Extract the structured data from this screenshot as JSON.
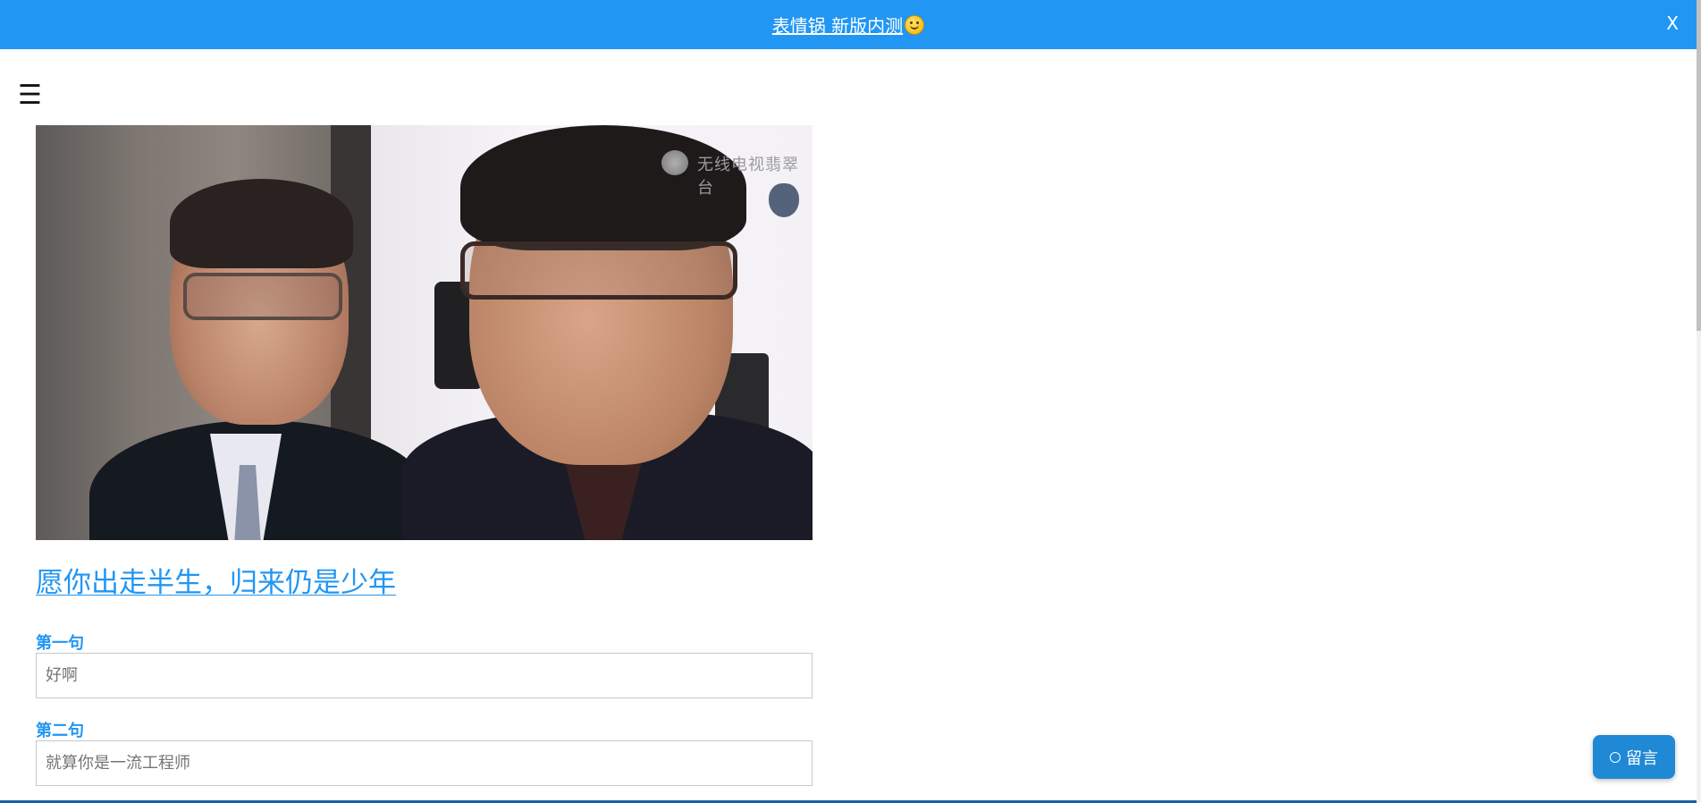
{
  "banner": {
    "promo_text": "表情锅 新版内测",
    "promo_icon": "smiling-face-emoji",
    "close_label": "X",
    "background_color": "#2196F3"
  },
  "nav": {
    "menu_icon": "☰"
  },
  "content": {
    "image_description": "two men in suits with glasses smiling",
    "image_logo_text": "无线电视翡翠台",
    "title": "愿你出走半生，归来仍是少年",
    "title_color": "#2196F3",
    "fields": [
      {
        "label": "第一句",
        "value": "",
        "placeholder": "好啊"
      },
      {
        "label": "第二句",
        "value": "",
        "placeholder": "就算你是一流工程师"
      }
    ]
  },
  "floating": {
    "comment_label": "留言",
    "comment_icon": "circle-icon",
    "button_color": "#1f89d6"
  }
}
